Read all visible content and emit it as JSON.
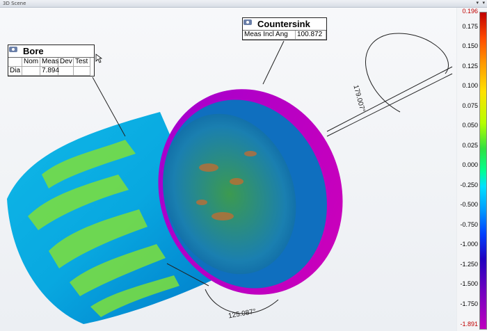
{
  "window": {
    "title": "3D Scene",
    "pin_glyph": "▾",
    "menu_glyph": "▾"
  },
  "colorbar": {
    "labels": [
      "0.196",
      "0.175",
      "0.150",
      "0.125",
      "0.100",
      "0.075",
      "0.050",
      "0.025",
      "0.000",
      "-0.250",
      "-0.500",
      "-0.750",
      "-1.000",
      "-1.250",
      "-1.500",
      "-1.750",
      "-1.891"
    ],
    "extreme_color": "#c00000"
  },
  "bore": {
    "title": "Bore",
    "headers": [
      "",
      "Nom",
      "Meas",
      "Dev",
      "Test"
    ],
    "rows": [
      [
        "Dia",
        "",
        "7.894",
        "",
        ""
      ]
    ]
  },
  "countersink": {
    "title": "Countersink",
    "label": "Meas Incl Ang",
    "value": "100.872"
  },
  "angles": {
    "angle1": "179.007°",
    "angle2": "125.087°"
  }
}
